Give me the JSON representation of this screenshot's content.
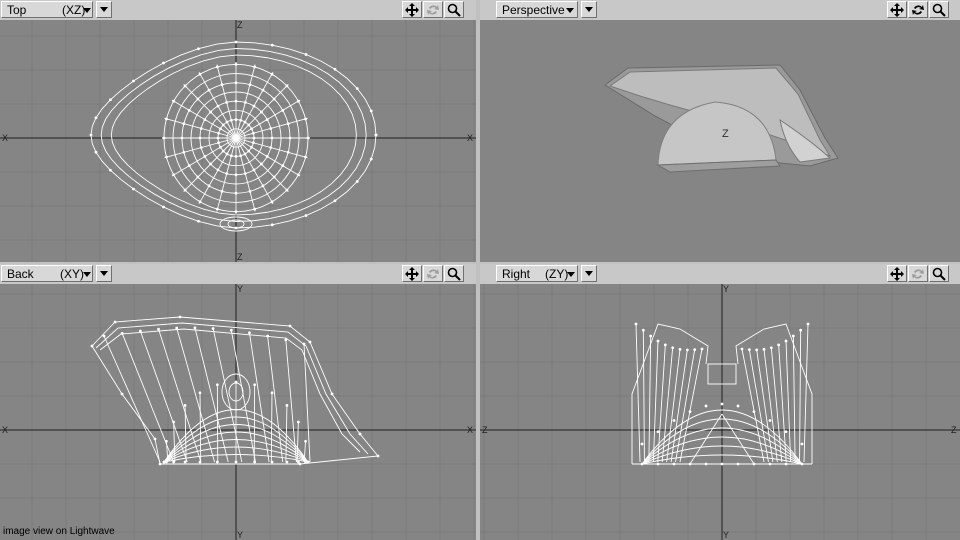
{
  "viewports": [
    {
      "id": "top",
      "view": "Top",
      "axes": "(XZ)",
      "show_axes": true,
      "tools": [
        "move-view-icon",
        "rotate-view-icon",
        "zoom-view-icon"
      ]
    },
    {
      "id": "perspective",
      "view": "Perspective",
      "axes": "",
      "show_axes": false,
      "tools": [
        "move-view-icon",
        "rotate-view-icon",
        "zoom-view-icon"
      ]
    },
    {
      "id": "back",
      "view": "Back",
      "axes": "(XY)",
      "show_axes": true,
      "tools": [
        "move-view-icon",
        "rotate-view-icon",
        "zoom-view-icon"
      ]
    },
    {
      "id": "right",
      "view": "Right",
      "axes": "(ZY)",
      "show_axes": true,
      "tools": [
        "move-view-icon",
        "rotate-view-icon",
        "zoom-view-icon"
      ]
    }
  ],
  "axis_labels": {
    "top": {
      "horizontal": "X",
      "vertical": "Z"
    },
    "perspective": {
      "object_label": "Z"
    },
    "back": {
      "horizontal": "X",
      "vertical": "Y"
    },
    "right": {
      "horizontal": "Z",
      "vertical": "Y"
    }
  },
  "caption": "image view on Lightwave",
  "colors": {
    "panel_bg": "#c0c0c0",
    "viewport_bg": "#858585",
    "grid": "#7a7a7a",
    "axis": "#202020",
    "wire": "#ffffff",
    "shaded": "#c8c8c8"
  }
}
